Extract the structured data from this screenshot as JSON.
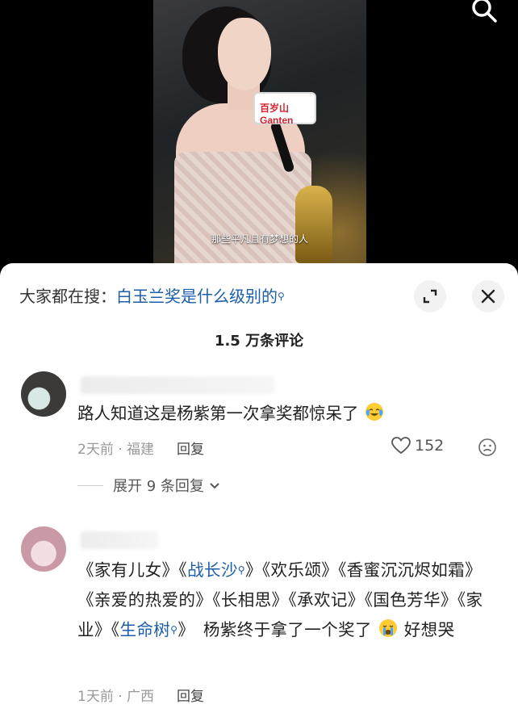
{
  "video": {
    "caption": "那些平凡且有梦想的人",
    "mic_flag_text": "百岁山 Ganten"
  },
  "sheet": {
    "trending_prefix": "大家都在搜：",
    "trending_query": "白玉兰奖是什么级别的",
    "comment_count": "1.5 万条评论"
  },
  "comments": [
    {
      "text": "路人知道这是杨紫第一次拿奖都惊呆了",
      "emoji": "crying-laughing-emoji",
      "time": "2天前",
      "location": "福建",
      "reply_label": "回复",
      "likes": "152",
      "expand_label": "展开 9 条回复"
    },
    {
      "segments": [
        "《家有儿女》《",
        "战长沙",
        "》《欢乐颂》《香蜜沉沉烬如霜》《亲爱的热爱的》《长相思》《承欢记》《国色芳华》《家业》《",
        "生命树",
        "》　杨紫终于拿了一个奖了",
        "好想哭"
      ],
      "emoji": "crying-emoji",
      "time": "1天前",
      "location": "广西",
      "reply_label": "回复"
    }
  ],
  "colors": {
    "link": "#1d5ea8",
    "meta_gray": "#999999",
    "sheet_bg": "#ffffff"
  }
}
